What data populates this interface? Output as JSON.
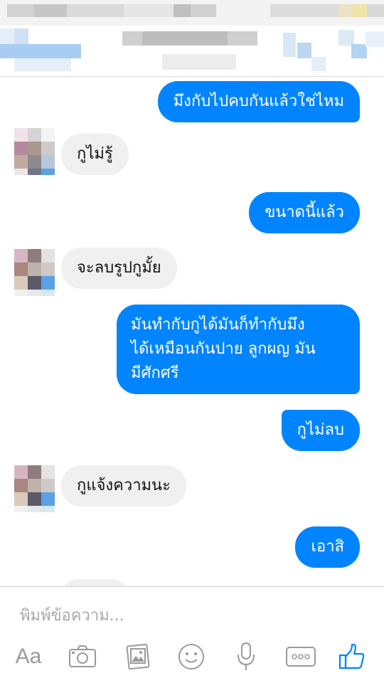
{
  "messages": [
    {
      "dir": "out",
      "text": "มึงกับไปคบกันแล้วใช่ไหม"
    },
    {
      "dir": "in",
      "text": "กูไม่รู้"
    },
    {
      "dir": "out",
      "text": "ขนาดนี้แล้ว"
    },
    {
      "dir": "in",
      "text": "จะลบรูปกูมั้ย"
    },
    {
      "dir": "out",
      "lines": [
        "มันทำกับกูได้มันก็ทำกับมึง",
        "ได้เหมือนกันปาย ลูกผญ มัน",
        "มีศักศรี"
      ]
    },
    {
      "dir": "out",
      "text": "กูไม่ลบ"
    },
    {
      "dir": "in",
      "text": "กูแจ้งความนะ"
    },
    {
      "dir": "out",
      "text": "เอาสิ"
    }
  ],
  "composer": {
    "placeholder": "พิมพ์ข้อความ...",
    "aa_label": "Aa"
  },
  "colors": {
    "outgoing_bubble": "#0084ff",
    "incoming_bubble": "#f1f0f0",
    "like_icon": "#0084ff",
    "toolbar_icon": "#9a9a9a"
  },
  "icons": [
    "camera-icon",
    "gallery-icon",
    "sticker-icon",
    "microphone-icon",
    "more-icon",
    "thumbs-up-icon"
  ]
}
